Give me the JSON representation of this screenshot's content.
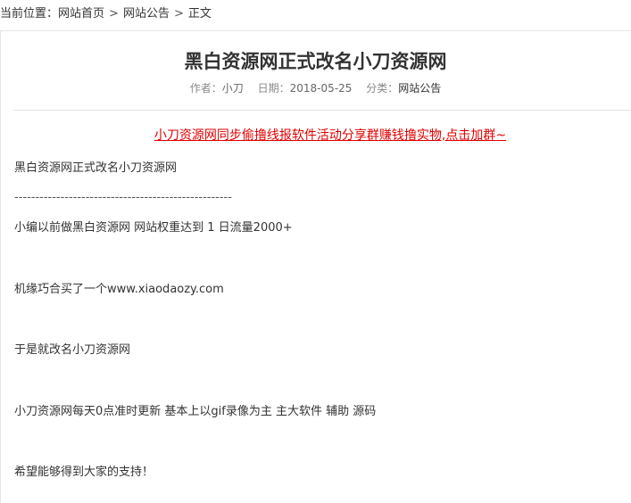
{
  "breadcrumb": {
    "prefix": "当前位置：",
    "home": "网站首页",
    "separator": ">",
    "category": "网站公告",
    "current": "正文"
  },
  "article": {
    "title": "黑白资源网正式改名小刀资源网",
    "meta": {
      "author_label": "作者：",
      "author": "小刀",
      "date_label": "日期：",
      "date": "2018-05-25",
      "category_label": "分类：",
      "category": "网站公告"
    },
    "promo_link": "小刀资源网同步偷撸线报软件活动分享群赚钱撸实物,点击加群~",
    "paragraphs": [
      "黑白资源网正式改名小刀资源网",
      "----------------------------------------------------",
      "小编以前做黑白资源网  网站权重达到 1  日流量2000+",
      "机缘巧合买了一个www.xiaodaozy.com",
      "于是就改名小刀资源网",
      "小刀资源网每天0点准时更新 基本上以gif录像为主  主大软件 辅助  源码",
      "希望能够得到大家的支持！"
    ]
  },
  "colors": {
    "promo_link": "#e10000",
    "text": "#333333",
    "meta": "#888888",
    "border": "#e6e6e6"
  }
}
